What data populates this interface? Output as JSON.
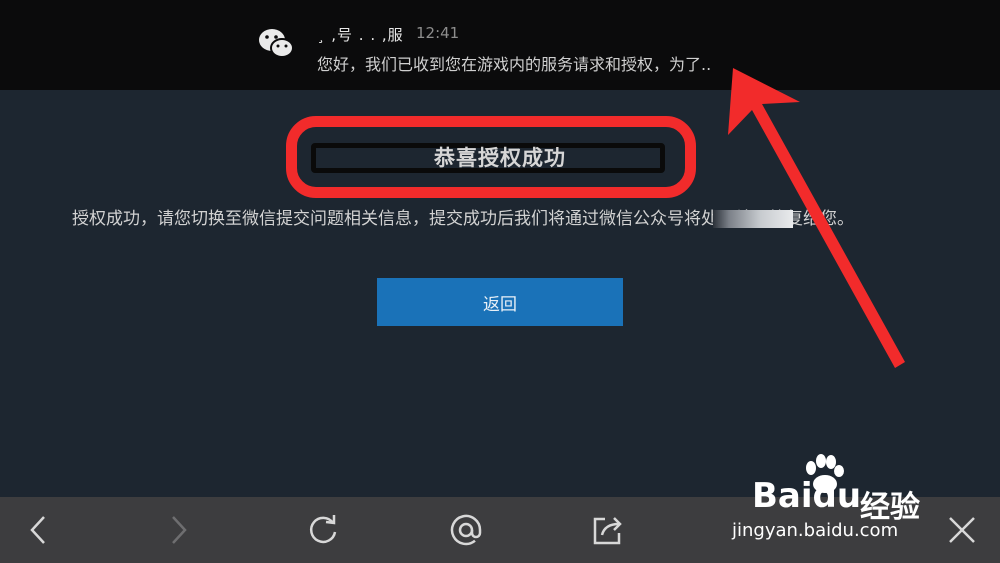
{
  "notification": {
    "sender": "¸ ,号 . .  ,服",
    "time": "12:41",
    "message": "您好，我们已收到您在游戏内的服务请求和授权，为了.."
  },
  "page": {
    "title": "恭喜授权成功",
    "body": "授权成功，请您切换至微信提交问题相关信息，提交成功后我们将通过微信公众号将处理结果答复给您。",
    "back_button": "返回"
  },
  "toolbar": {
    "items": [
      "back-icon",
      "forward-icon",
      "refresh-icon",
      "at-icon",
      "share-icon",
      "close-icon"
    ]
  },
  "watermark": {
    "brand": "Bai",
    "brand_du": "du",
    "brand_cn": "经验",
    "url": "jingyan.baidu.com"
  },
  "colors": {
    "highlight": "#f22b2b",
    "button": "#1a72b8",
    "background": "#1d2630",
    "toolbar": "#3d3d3f"
  }
}
